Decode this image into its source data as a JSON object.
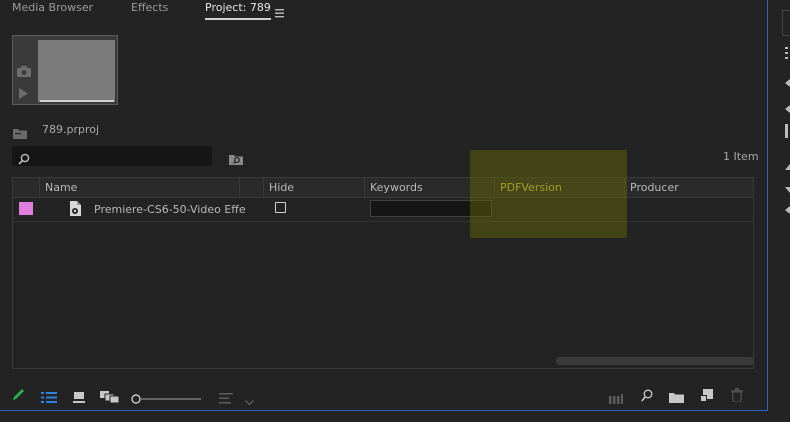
{
  "tabs": [
    {
      "label": "Media Browser"
    },
    {
      "label": "Effects"
    },
    {
      "label": "Project: 789"
    }
  ],
  "project": {
    "file_name": "789.prproj",
    "item_count": "1 Item",
    "search": {
      "value": "",
      "placeholder": ""
    }
  },
  "table": {
    "columns": [
      "Name",
      "Hide",
      "Keywords",
      "PDFVersion",
      "Producer"
    ],
    "rows": [
      {
        "label_color": "#e07ee0",
        "name": "Premiere-CS6-50-Video Effe",
        "hide": false,
        "keywords": "",
        "pdf_version": "",
        "producer": ""
      }
    ]
  },
  "colors": {
    "accent_blue": "#2d63c8",
    "highlight": "#5a5a00",
    "highlight_text": "#c8c040",
    "pencil_green": "#27b34a"
  },
  "icons": {
    "tab_menu": "hamburger-icon",
    "thumb_camera": "camera-icon",
    "thumb_play": "play-icon",
    "project_folder": "folder-icon",
    "search": "search-icon",
    "find": "find-bin-icon",
    "file": "sequence-file-icon"
  },
  "bottom_toolbar": {
    "icons": [
      "pencil-icon",
      "list-view-icon",
      "icon-view-icon",
      "freeform-view-icon",
      "zoom-slider",
      "sort-icon",
      "sort-dropdown-icon",
      "automate-icon",
      "find-icon",
      "new-bin-icon",
      "new-item-icon",
      "trash-icon"
    ]
  }
}
